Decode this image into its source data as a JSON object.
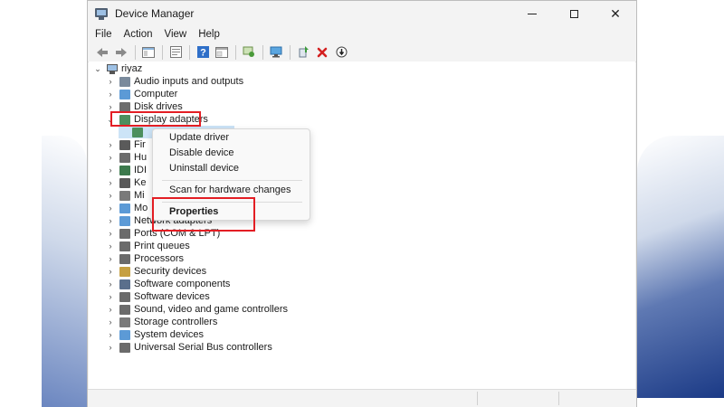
{
  "window": {
    "title": "Device Manager",
    "controls": {
      "minimize": "—",
      "maximize": "☐",
      "close": "✕"
    }
  },
  "menu": [
    "File",
    "Action",
    "View",
    "Help"
  ],
  "toolbar": {
    "icons": [
      "back-arrow-icon",
      "forward-arrow-icon",
      "show-hide-tree-icon",
      "properties-icon",
      "help-icon",
      "view-icon",
      "update-driver-icon",
      "scan-hardware-icon",
      "add-driver-icon",
      "uninstall-icon",
      "disable-icon"
    ]
  },
  "tree": {
    "root": "riyaz",
    "items": [
      {
        "label": "Audio inputs and outputs",
        "icon": "speaker-icon",
        "color": "#7a8a9c"
      },
      {
        "label": "Computer",
        "icon": "computer-icon",
        "color": "#5c9ad6"
      },
      {
        "label": "Disk drives",
        "icon": "disk-icon",
        "color": "#6d6d6d"
      },
      {
        "label": "Display adapters",
        "icon": "display-adapter-icon",
        "color": "#4c8f5e"
      },
      {
        "label": "",
        "icon": "display-adapter-child-icon",
        "color": "#4c8f5e"
      },
      {
        "label": "Fir",
        "icon": "firmware-icon",
        "color": "#5a5a5a"
      },
      {
        "label": "Hu",
        "icon": "hid-icon",
        "color": "#6b6b6b"
      },
      {
        "label": "IDI",
        "icon": "ide-icon",
        "color": "#3d7a4d"
      },
      {
        "label": "Ke",
        "icon": "keyboard-icon",
        "color": "#5a5a5a"
      },
      {
        "label": "Mi",
        "icon": "mouse-icon",
        "color": "#7a7a7a"
      },
      {
        "label": "Mo",
        "icon": "monitor-icon",
        "color": "#5c9ad6"
      },
      {
        "label": "Network adapters",
        "icon": "network-icon",
        "color": "#5c9ad6"
      },
      {
        "label": "Ports (COM & LPT)",
        "icon": "port-icon",
        "color": "#6b6b6b"
      },
      {
        "label": "Print queues",
        "icon": "printer-icon",
        "color": "#6b6b6b"
      },
      {
        "label": "Processors",
        "icon": "processor-icon",
        "color": "#6b6b6b"
      },
      {
        "label": "Security devices",
        "icon": "security-icon",
        "color": "#c6a042"
      },
      {
        "label": "Software components",
        "icon": "software-component-icon",
        "color": "#5a6f8c"
      },
      {
        "label": "Software devices",
        "icon": "software-device-icon",
        "color": "#6b6b6b"
      },
      {
        "label": "Sound, video and game controllers",
        "icon": "sound-icon",
        "color": "#6b6b6b"
      },
      {
        "label": "Storage controllers",
        "icon": "storage-icon",
        "color": "#7a7a7a"
      },
      {
        "label": "System devices",
        "icon": "system-icon",
        "color": "#5c9ad6"
      },
      {
        "label": "Universal Serial Bus controllers",
        "icon": "usb-icon",
        "color": "#6b6b6b"
      }
    ]
  },
  "context_menu": {
    "items": [
      "Update driver",
      "Disable device",
      "Uninstall device",
      "Scan for hardware changes",
      "Properties"
    ]
  },
  "colors": {
    "highlight": "#e31e24",
    "selection": "#cce4f7"
  }
}
